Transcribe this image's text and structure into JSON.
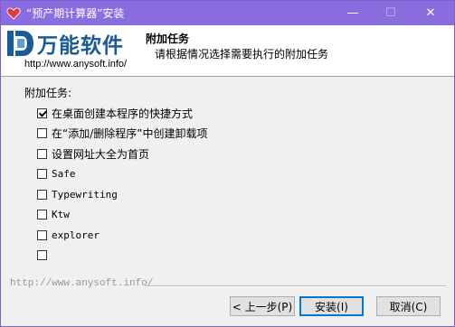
{
  "window": {
    "title": "“预产期计算器”安装"
  },
  "titlebar": {
    "minimize_glyph": "—",
    "maximize_glyph": "☐",
    "close_glyph": "✕"
  },
  "header": {
    "logo_text": "万能软件",
    "logo_url": "http://www.anysoft.info/",
    "title": "附加任务",
    "subtitle": "请根据情况选择需要执行的附加任务"
  },
  "tasks": {
    "group_label": "附加任务:",
    "options": [
      {
        "label": "在桌面创建本程序的快捷方式",
        "checked": true
      },
      {
        "label": "在“添加/删除程序”中创建卸载项",
        "checked": false
      },
      {
        "label": "设置网址大全为首页",
        "checked": false
      },
      {
        "label": "Safe",
        "checked": false
      },
      {
        "label": "Typewriting",
        "checked": false
      },
      {
        "label": "Ktw",
        "checked": false
      },
      {
        "label": "explorer",
        "checked": false
      },
      {
        "label": "",
        "checked": false
      }
    ]
  },
  "footer": {
    "branding": "http://www.anysoft.info/",
    "back_label": "< 上一步(P)",
    "install_label": "安装(I)",
    "cancel_label": "取消(C)"
  },
  "colors": {
    "titlebar": "#8a6ee0",
    "logo": "#1a5a96",
    "focus": "#0078d7"
  }
}
